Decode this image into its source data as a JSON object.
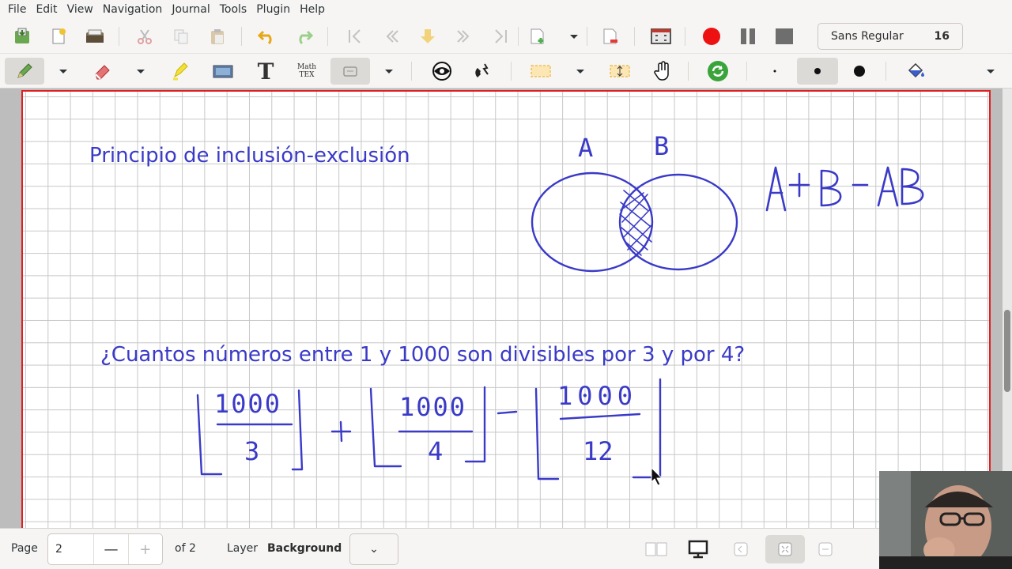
{
  "menu": [
    "File",
    "Edit",
    "View",
    "Navigation",
    "Journal",
    "Tools",
    "Plugin",
    "Help"
  ],
  "toolbar": {
    "font_name": "Sans Regular",
    "font_size": "16",
    "tex_label_top": "Math",
    "tex_label_bottom": "TEX",
    "text_tool_glyph": "T"
  },
  "page_content": {
    "title": "Principio de inclusión-exclusión",
    "question": "¿Cuantos números entre 1 y 1000 son divisibles por 3 y por 4?",
    "handwriting": {
      "set_a": "A",
      "set_b": "B",
      "formula": "A+B-AB",
      "numerator_1": "1000",
      "denominator_1": "3",
      "numerator_2": "1000",
      "denominator_2": "4",
      "numerator_3": "1000",
      "denominator_3": "12"
    },
    "ink_color": "#3a3ac8",
    "page_border_color": "#e02020"
  },
  "statusbar": {
    "page_label": "Page",
    "page_value": "2",
    "minus": "—",
    "plus": "+",
    "of_pages": "of 2",
    "layer_label": "Layer",
    "layer_value": "Background",
    "layer_dropdown": "⌄"
  }
}
